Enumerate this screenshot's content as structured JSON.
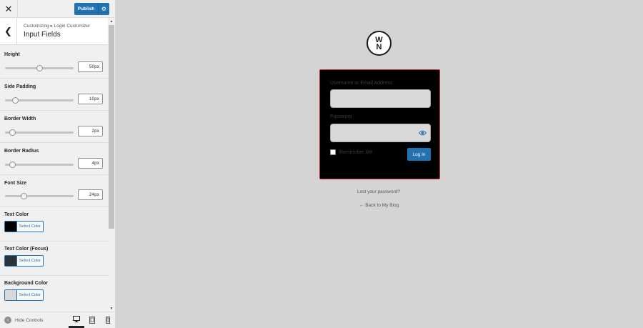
{
  "topbar": {
    "close_icon": "close-icon",
    "publish_label": "Publish",
    "settings_icon": "gear-icon"
  },
  "section": {
    "breadcrumb": "Customizing ▸ Login Customizer",
    "title": "Input Fields"
  },
  "controls": {
    "sliders": [
      {
        "label": "Height",
        "value": "50px",
        "position": 0.5
      },
      {
        "label": "Side Padding",
        "value": "10px",
        "position": 0.15
      },
      {
        "label": "Border Width",
        "value": "2px",
        "position": 0.1
      },
      {
        "label": "Border Radius",
        "value": "4px",
        "position": 0.1
      },
      {
        "label": "Font Size",
        "value": "24px",
        "position": 0.27
      }
    ],
    "colors": [
      {
        "label": "Text Color",
        "button": "Select Color",
        "swatch": "#000000"
      },
      {
        "label": "Text Color (Focus)",
        "button": "Select Color",
        "swatch": "#2c3338"
      },
      {
        "label": "Background Color",
        "button": "Select Color",
        "swatch": "#d9d9d9"
      }
    ]
  },
  "footer": {
    "hide_controls_label": "Hide Controls"
  },
  "preview": {
    "username_label": "Username or Email Address",
    "password_label": "Password",
    "remember_label": "Remember Me",
    "login_button": "Log In",
    "lost_password": "Lost your password?",
    "back_link": "← Back to My Blog",
    "logo_top": "W",
    "logo_bottom": "N"
  },
  "colors": {
    "accent": "#2271b1",
    "login_box_bg": "#000000",
    "login_box_border": "#c02b3c",
    "preview_bg": "#d4d4d4"
  }
}
